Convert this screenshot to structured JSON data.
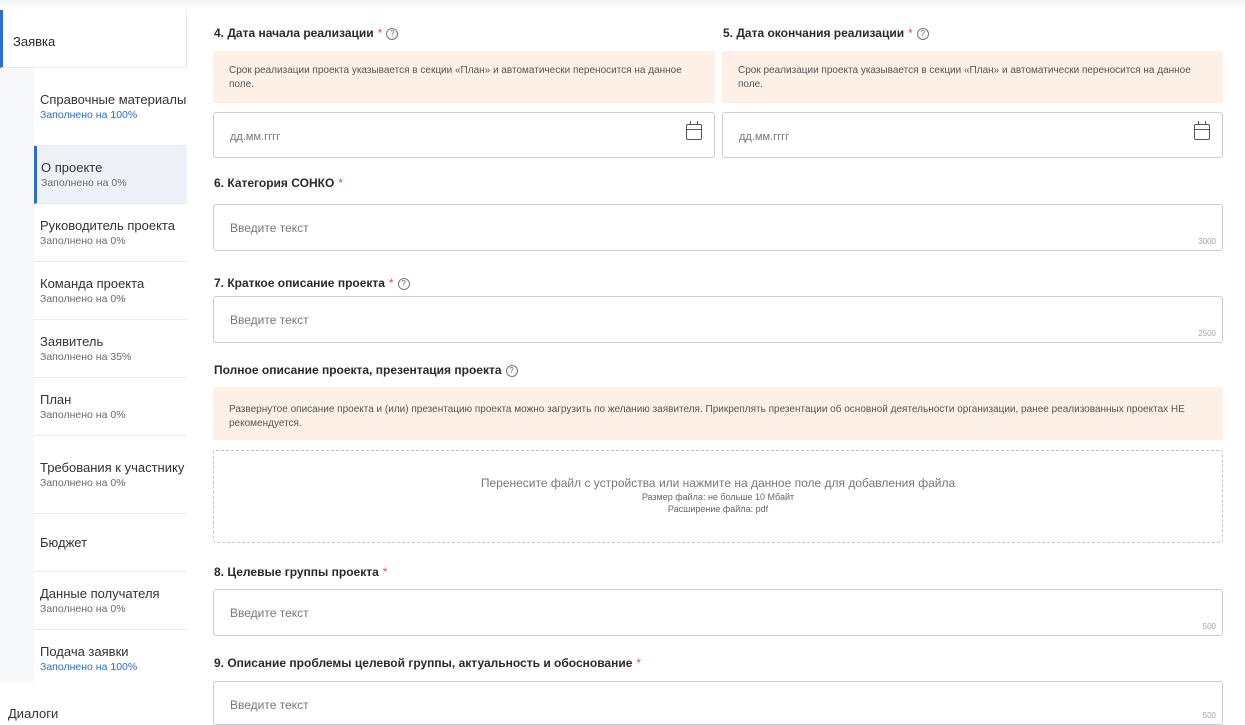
{
  "sidebar": {
    "top_label": "Заявка",
    "items": [
      {
        "label": "Справочные материалы",
        "status": "Заполнено на 100%",
        "full": true
      },
      {
        "label": "О проекте",
        "status": "Заполнено на 0%",
        "active": true
      },
      {
        "label": "Руководитель проекта",
        "status": "Заполнено на 0%"
      },
      {
        "label": "Команда проекта",
        "status": "Заполнено на 0%"
      },
      {
        "label": "Заявитель",
        "status": "Заполнено на 35%"
      },
      {
        "label": "План",
        "status": "Заполнено на 0%"
      },
      {
        "label": "Требования к участнику",
        "status": "Заполнено на 0%"
      },
      {
        "label": "Бюджет",
        "status": ""
      },
      {
        "label": "Данные получателя",
        "status": "Заполнено на 0%"
      },
      {
        "label": "Подача заявки",
        "status": "Заполнено на 100%",
        "full": true
      }
    ],
    "bottom_label": "Диалоги"
  },
  "form": {
    "q4": {
      "label": "4. Дата начала реализации",
      "note": "Срок реализации проекта указывается в секции «План» и автоматически переносится на данное поле.",
      "placeholder": "дд.мм.гггг"
    },
    "q5": {
      "label": "5. Дата окончания реализации",
      "note": "Срок реализации проекта указывается в секции «План» и автоматически переносится на данное поле.",
      "placeholder": "дд.мм.гггг"
    },
    "q6": {
      "label": "6. Категория СОНКО",
      "placeholder": "Введите текст",
      "limit": "3000"
    },
    "q7": {
      "label": "7. Краткое описание проекта",
      "placeholder": "Введите текст",
      "limit": "2500"
    },
    "full_desc": {
      "label": "Полное описание проекта, презентация проекта",
      "note": "Развернутое описание проекта и (или) презентацию проекта можно загрузить по желанию заявителя. Прикреплять презентации об основной деятельности организации, ранее реализованных проектах НЕ рекомендуется.",
      "drop_text": "Перенесите файл с устройства или нажмите на данное поле для добавления файла",
      "size_text": "Размер файла: не больше 10 Мбайт",
      "ext_text": "Расширение файла: pdf"
    },
    "q8": {
      "label": "8. Целевые группы проекта",
      "placeholder": "Введите текст",
      "limit": "500"
    },
    "q9": {
      "label": "9. Описание проблемы целевой группы, актуальность и обоснование",
      "placeholder": "Введите текст",
      "limit": "500"
    },
    "required_mark": "*",
    "help_glyph": "?"
  }
}
